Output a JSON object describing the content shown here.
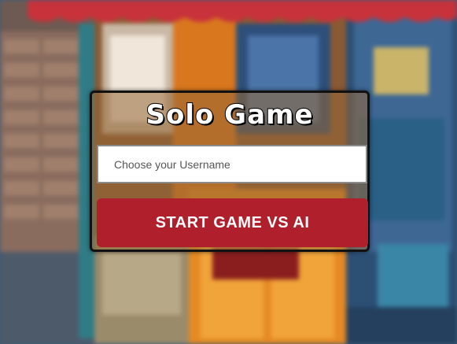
{
  "menu": {
    "title": "Solo Game",
    "username_placeholder": "Choose your Username",
    "username_value": "",
    "start_button_label": "START GAME VS AI"
  },
  "colors": {
    "button": "#b01f2c",
    "panel_border": "#111111",
    "title_text": "#ffffff"
  }
}
